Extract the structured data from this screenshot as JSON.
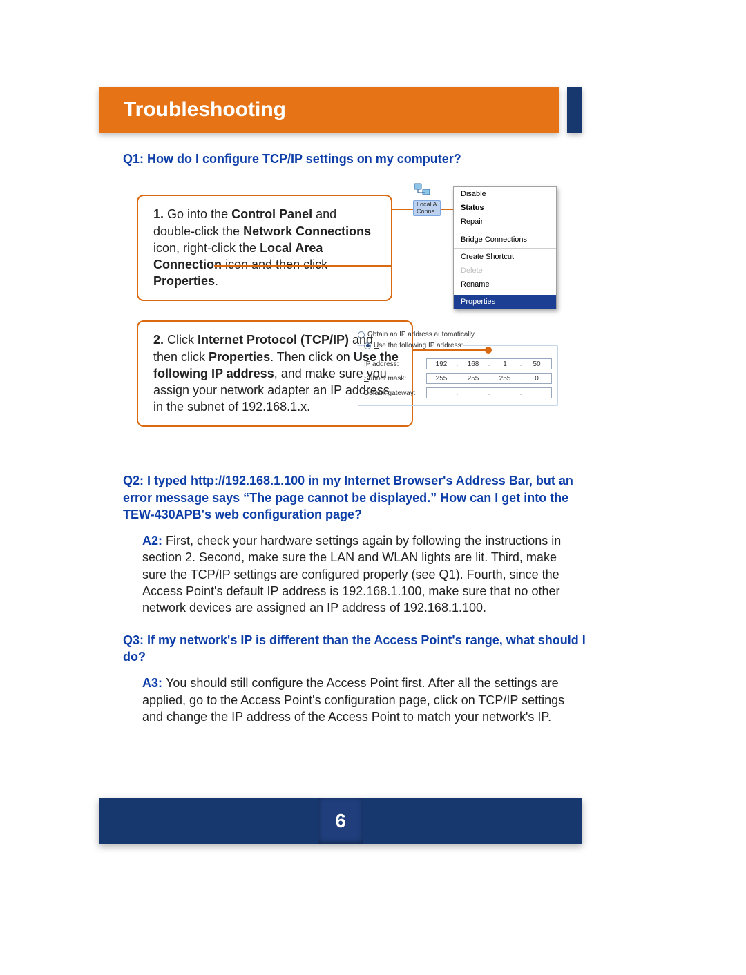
{
  "page_title": "Troubleshooting",
  "page_number": "6",
  "q1": {
    "prefix": "Q1:  ",
    "text": "How do I configure TCP/IP settings on my computer?"
  },
  "step1": {
    "num": "1.",
    "t1": " Go into the ",
    "b1": "Control Panel",
    "t2": " and double-click the ",
    "b2": "Network Connections",
    "t3": " icon, right-click the ",
    "b3": "Local Area Connection",
    "t4": " icon and then click ",
    "b4": "Properties",
    "t5": "."
  },
  "context_menu": {
    "icon_label_line1": "Local A",
    "icon_label_line2": "Conne",
    "items": [
      {
        "label": "Disable",
        "bold": false
      },
      {
        "label": "Status",
        "bold": true
      },
      {
        "label": "Repair",
        "bold": false
      },
      {
        "label": "Bridge Connections",
        "bold": false,
        "sep_before": true
      },
      {
        "label": "Create Shortcut",
        "bold": false,
        "sep_before": true
      },
      {
        "label": "Delete",
        "bold": false,
        "dim": true
      },
      {
        "label": "Rename",
        "bold": false
      },
      {
        "label": "Properties",
        "bold": false,
        "selected": true,
        "sep_before": true
      }
    ]
  },
  "step2": {
    "num": "2.",
    "t1": " Click ",
    "b1": "Internet Protocol (TCP/IP)",
    "t2": " and then click ",
    "b2": "Properties",
    "t3": ".  Then click on ",
    "b3": "Use the following IP address",
    "t4": ", and make sure you assign your network adapter an IP address in the subnet of 192.168.1.x."
  },
  "ipdialog": {
    "radio_auto_pre": "O",
    "radio_auto_label": "btain an IP address automatically",
    "radio_manual_pre": "U",
    "radio_manual_label": "se the following IP address:",
    "row_ip_key": "I",
    "row_ip_label": "P address:",
    "row_mask_key": "S",
    "row_mask_label": "ubnet mask:",
    "row_gw_key": "D",
    "row_gw_label": "efault gateway:",
    "ip": [
      "192",
      "168",
      "1",
      "50"
    ],
    "mask": [
      "255",
      "255",
      "255",
      "0"
    ],
    "gw": [
      "",
      "",
      "",
      ""
    ]
  },
  "q2": {
    "prefix": "Q2:  ",
    "text": "I typed http://192.168.1.100 in my Internet Browser's Address Bar, but an error message says “The page cannot be displayed.” How can I get into the TEW-430APB's web configuration page?"
  },
  "a2": {
    "prefix": "A2: ",
    "text": "First, check your hardware settings again by following the instructions in section 2.  Second, make sure the LAN and WLAN lights are lit.  Third, make sure the TCP/IP settings are configured properly (see Q1).   Fourth, since the Access Point's default IP address is 192.168.1.100, make sure that no other network devices are assigned an IP address of 192.168.1.100."
  },
  "q3": {
    "prefix": "Q3:  ",
    "text": "If my network's IP is different than the Access Point's range, what should I do?"
  },
  "a3": {
    "prefix": "A3: ",
    "text": "You should still configure the Access Point first. After all the settings are applied, go to the Access Point's configuration page, click on TCP/IP settings and change the IP address of the Access Point to match your network's IP."
  }
}
